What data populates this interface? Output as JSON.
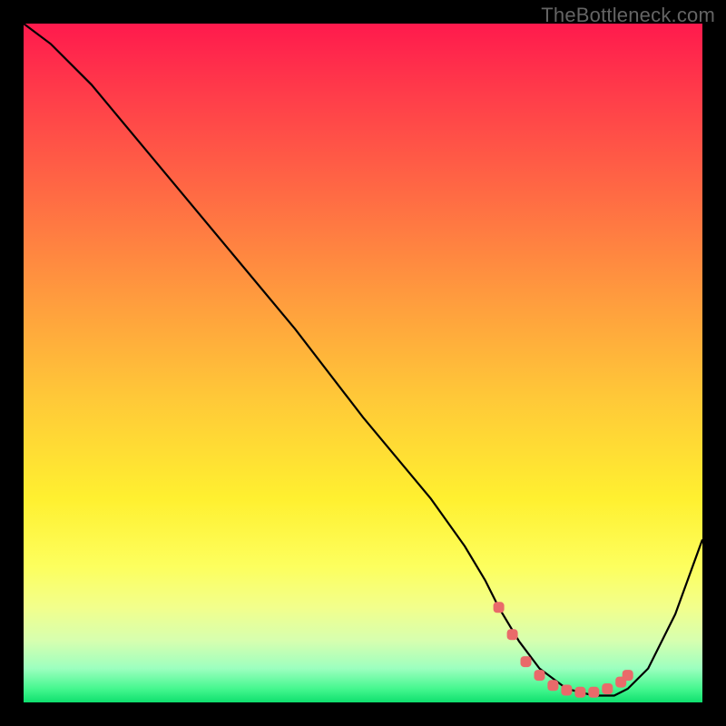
{
  "watermark": "TheBottleneck.com",
  "chart_data": {
    "type": "line",
    "title": "",
    "xlabel": "",
    "ylabel": "",
    "xlim": [
      0,
      100
    ],
    "ylim": [
      0,
      100
    ],
    "series": [
      {
        "name": "bottleneck-curve",
        "x": [
          0,
          4,
          10,
          20,
          30,
          40,
          50,
          60,
          65,
          68,
          70,
          73,
          76,
          80,
          84,
          87,
          89,
          92,
          96,
          100
        ],
        "y": [
          100,
          97,
          91,
          79,
          67,
          55,
          42,
          30,
          23,
          18,
          14,
          9,
          5,
          2,
          1,
          1,
          2,
          5,
          13,
          24
        ]
      }
    ],
    "markers": {
      "name": "highlight-dots",
      "color": "#e96a6a",
      "x": [
        70,
        72,
        74,
        76,
        78,
        80,
        82,
        84,
        86,
        88,
        89
      ],
      "y": [
        14,
        10,
        6,
        4,
        2.5,
        1.8,
        1.5,
        1.5,
        2,
        3,
        4
      ]
    },
    "gradient_stops": [
      {
        "pct": 0,
        "color": "#ff1a4d"
      },
      {
        "pct": 10,
        "color": "#ff3b4a"
      },
      {
        "pct": 25,
        "color": "#ff6a44"
      },
      {
        "pct": 40,
        "color": "#ff9a3e"
      },
      {
        "pct": 55,
        "color": "#ffc838"
      },
      {
        "pct": 70,
        "color": "#fff030"
      },
      {
        "pct": 80,
        "color": "#fdff5e"
      },
      {
        "pct": 86,
        "color": "#f2ff8c"
      },
      {
        "pct": 91,
        "color": "#d6ffb0"
      },
      {
        "pct": 95,
        "color": "#9cffbf"
      },
      {
        "pct": 98,
        "color": "#45f78f"
      },
      {
        "pct": 100,
        "color": "#0fe06e"
      }
    ]
  }
}
